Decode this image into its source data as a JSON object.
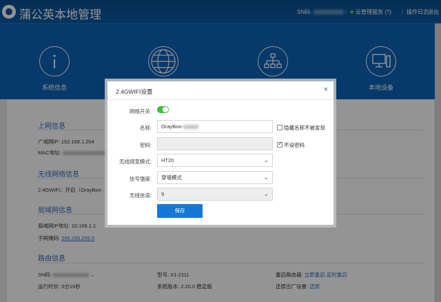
{
  "header": {
    "app_title": "蒲公英本地管理",
    "sn_label": "SN码:",
    "cloud_label": "云管理服务",
    "help_label": "(?)",
    "log_label": "操作日志",
    "logout_label": "退出"
  },
  "nav": {
    "items": [
      {
        "label": "系统信息",
        "icon": "info-icon"
      },
      {
        "label": "",
        "icon": "globe-icon"
      },
      {
        "label": "",
        "icon": "network-topology-icon"
      },
      {
        "label": "本地设备",
        "icon": "monitor-icon"
      }
    ]
  },
  "content": {
    "internet": {
      "title": "上网信息",
      "wan_ip_label": "广域网IP:",
      "wan_ip_value": "192.168.1.204",
      "mac_label": "MAC地址:"
    },
    "wireless": {
      "title": "无线网络信息",
      "wifi_line": "2.4GWIFI：开启（OrayBox-"
    },
    "lan": {
      "title": "局域网信息",
      "lan_ip_label": "局域网IP地址:",
      "lan_ip_value": "10.168.1.1",
      "mask_label": "子网掩码:",
      "mask_value": "255.255.255.0"
    },
    "router": {
      "title": "路由信息",
      "sn_label": "SN码:",
      "runtime_label": "运行时长:",
      "runtime_value": "5分16秒",
      "model_label": "型号:",
      "model_value": "X1-2111",
      "version_label": "系统版本:",
      "version_value": "2.20.0 稳定版",
      "reboot_label": "重启路由器:",
      "reboot_now": "立即重启",
      "reboot_timed": "定时重启",
      "factory_label": "还原出厂设置:",
      "factory_action": "还原"
    }
  },
  "modal": {
    "title": "2.4GWIFI设置",
    "close_glyph": "×",
    "switch_label": "网络开关:",
    "switch_on": true,
    "name_label": "名称:",
    "name_value": "OrayBox-",
    "hide_name_label": "隐藏名称不被发现",
    "hide_name_checked": false,
    "password_label": "密码:",
    "no_password_label": "不设密码",
    "no_password_checked": true,
    "bandwidth_label": "无线频宽模式:",
    "bandwidth_value": "HT20",
    "signal_label": "信号强度:",
    "signal_value": "穿墙模式",
    "channel_label": "无线信道:",
    "channel_value": "9",
    "save_label": "保存",
    "dropdown_glyph": "⌄"
  },
  "colors": {
    "header_bg": "#0b5394",
    "nav_bg": "#0d63b8",
    "accent": "#2a6fc3",
    "toggle_on": "#3fbf3f",
    "save_button": "#1677d6",
    "status_dot": "#44d34a"
  }
}
